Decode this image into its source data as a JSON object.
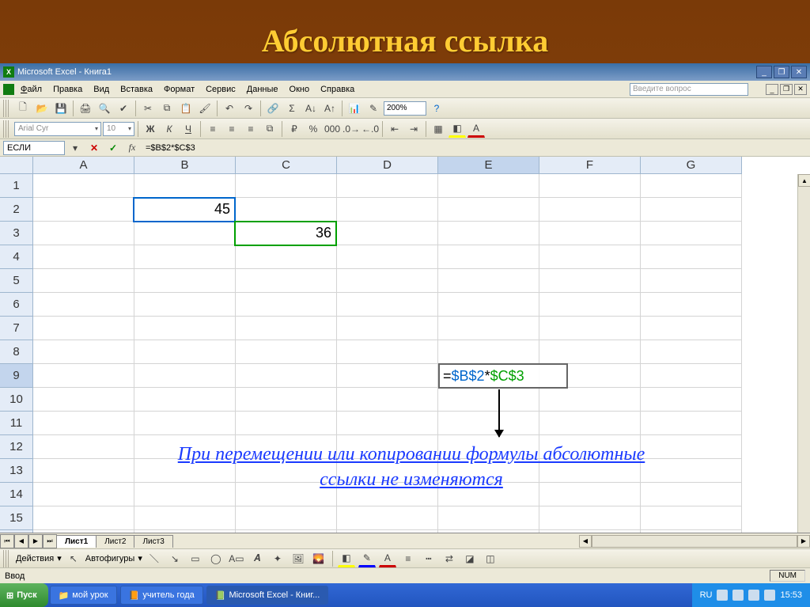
{
  "slide": {
    "title": "Абсолютная ссылка"
  },
  "titlebar": {
    "app": "Microsoft Excel - Книга1"
  },
  "menu": {
    "file": "Файл",
    "edit": "Правка",
    "view": "Вид",
    "insert": "Вставка",
    "format": "Формат",
    "tools": "Сервис",
    "data": "Данные",
    "window": "Окно",
    "help": "Справка",
    "ask": "Введите вопрос"
  },
  "toolbar": {
    "zoom": "200%"
  },
  "format": {
    "font": "Arial Cyr",
    "size": "10"
  },
  "formula_bar": {
    "name": "ЕСЛИ",
    "formula": "=$B$2*$C$3"
  },
  "columns": [
    "A",
    "B",
    "C",
    "D",
    "E",
    "F",
    "G"
  ],
  "rows_count": 16,
  "cells": {
    "B2": "45",
    "C3": "36"
  },
  "active_cell": "E9",
  "e9": {
    "ref1": "$B$2",
    "op": "*",
    "ref2": "$C$3",
    "eq": "="
  },
  "note": "При перемещении или копировании формулы абсолютные ссылки не изменяются",
  "sheets": {
    "s1": "Лист1",
    "s2": "Лист2",
    "s3": "Лист3"
  },
  "draw": {
    "actions": "Действия",
    "autoshapes": "Автофигуры"
  },
  "status": {
    "mode": "Ввод",
    "num": "NUM"
  },
  "taskbar": {
    "start": "Пуск",
    "t1": "мой урок",
    "t2": "учитель года",
    "t3": "Microsoft Excel - Книг...",
    "time": "15:53",
    "lang": "RU"
  }
}
